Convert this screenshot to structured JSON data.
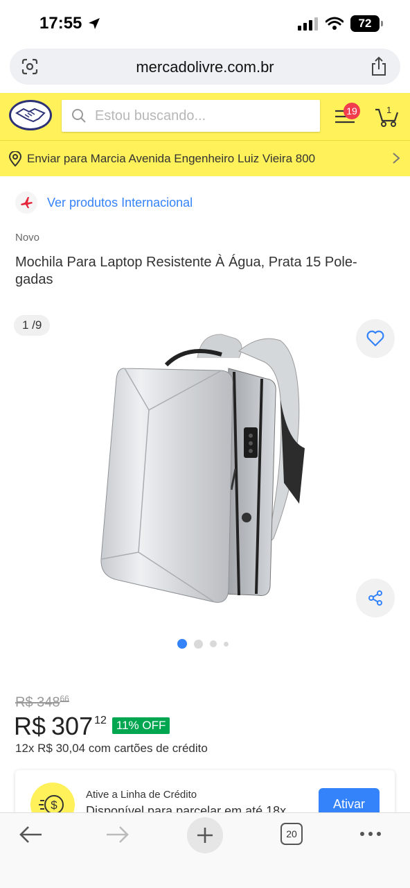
{
  "status_bar": {
    "time": "17:55",
    "battery": "72"
  },
  "browser": {
    "url": "mercadolivre.com.br",
    "tab_count": "20"
  },
  "header": {
    "search_placeholder": "Estou buscando...",
    "menu_badge": "19",
    "cart_count": "1"
  },
  "address": {
    "text": "Enviar para Marcia Avenida Engenheiro Luiz Vieira 800"
  },
  "international": {
    "label": "Ver produtos Internacional"
  },
  "product": {
    "condition": "Novo",
    "title": "Mochila Para Laptop Resistente À Água, Prata 15 Pole-gadas",
    "image_counter": "1 /9",
    "old_price_int": "R$ 348",
    "old_price_cents": "66",
    "currency": "R$",
    "price_int": "307",
    "price_cents": "12",
    "discount": "11% OFF",
    "installments": "12x R$ 30,04 com cartões de crédito"
  },
  "credit": {
    "title": "Ative a Linha de Crédito",
    "subtitle": "Disponível para parcelar em até 18x",
    "button": "Ativar"
  },
  "colors": {
    "brand_yellow": "#fff159",
    "link_blue": "#3483fa",
    "discount_green": "#00a650",
    "badge_red": "#f23d4f"
  }
}
